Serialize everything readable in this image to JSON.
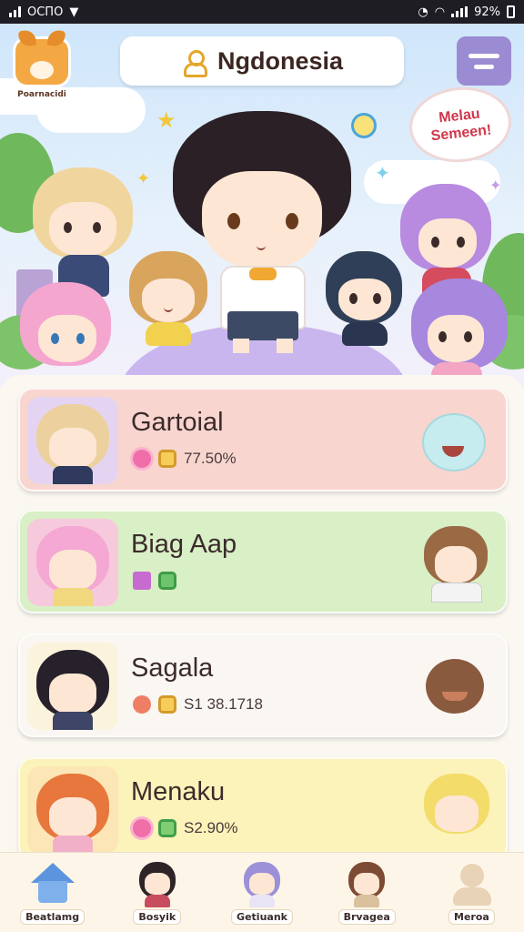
{
  "status_bar": {
    "left_text": "ОСПО",
    "battery": "92%"
  },
  "header": {
    "logo_label": "Poarnacidi",
    "title": "Ngdonesia",
    "speech_bubble": "Melau Semeen!"
  },
  "games": [
    {
      "name": "Gartoial",
      "value": "77.50%",
      "color": "#f8d6cf"
    },
    {
      "name": "Biag Aap",
      "value": "",
      "color": "#d9efc6"
    },
    {
      "name": "Sagala",
      "value": "S1 38.1718",
      "color": "#faf6f2"
    },
    {
      "name": "Menaku",
      "value": "S2.90%",
      "color": "#fbf3b9"
    }
  ],
  "nav": [
    {
      "label": "Beatlamg"
    },
    {
      "label": "Bosyik"
    },
    {
      "label": "Getiuank"
    },
    {
      "label": "Brvagea"
    },
    {
      "label": "Meroa"
    }
  ]
}
